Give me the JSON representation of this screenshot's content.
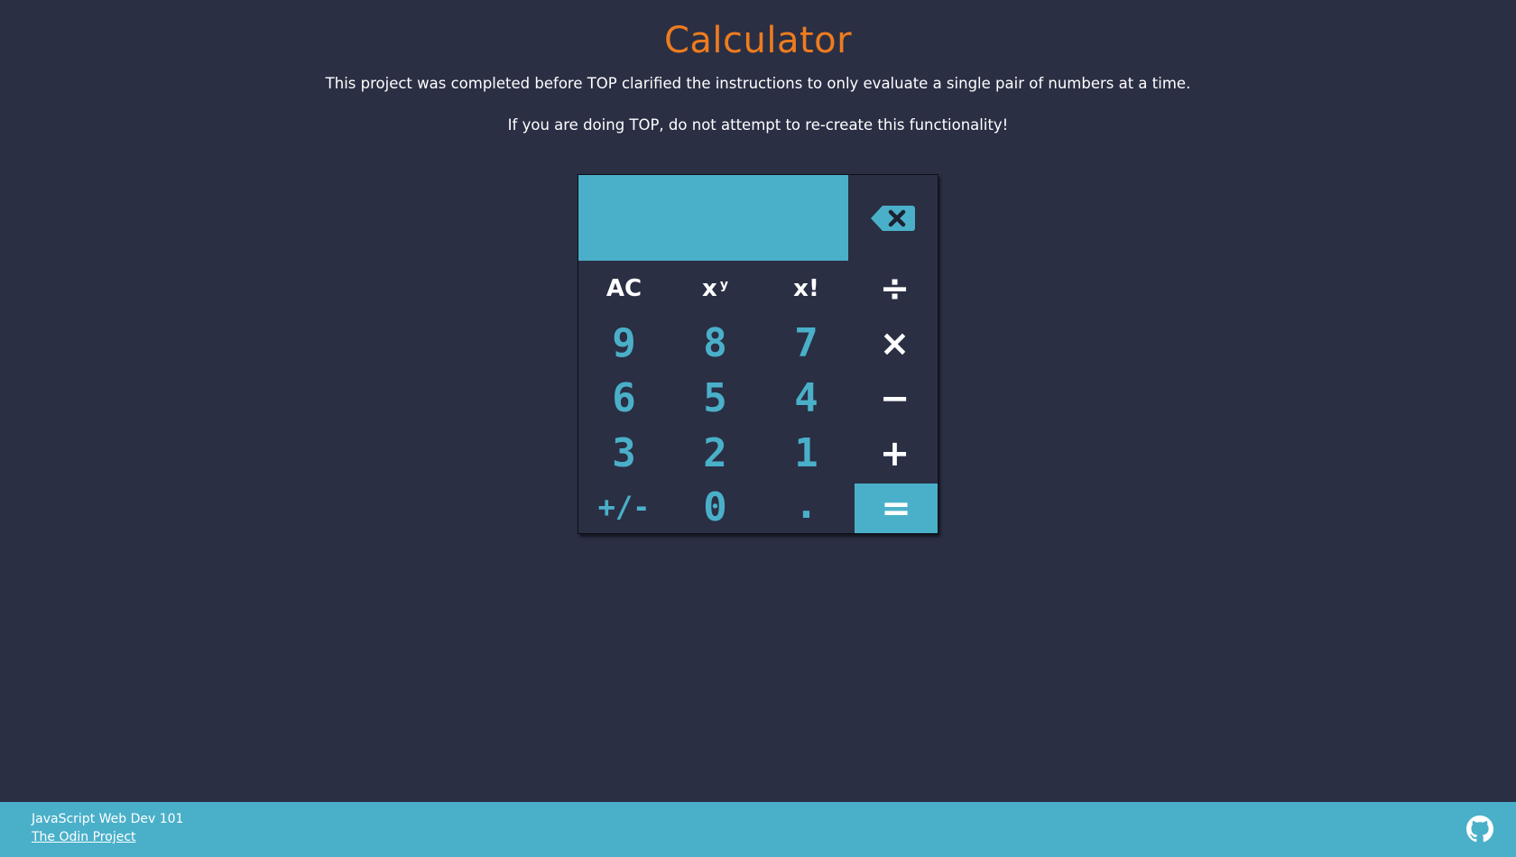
{
  "header": {
    "title": "Calculator",
    "note_1": "This project was completed before TOP clarified the instructions to only evaluate a single pair of numbers at a time.",
    "note_2": "If you are doing TOP, do not attempt to re-create this functionality!"
  },
  "calculator": {
    "display_value": "",
    "backspace_icon": "backspace-icon",
    "keys": {
      "clear": "AC",
      "power_base": "x",
      "power_exp": "y",
      "factorial": "x!",
      "divide": "÷",
      "nine": "9",
      "eight": "8",
      "seven": "7",
      "multiply": "×",
      "six": "6",
      "five": "5",
      "four": "4",
      "subtract": "−",
      "three": "3",
      "two": "2",
      "one": "1",
      "add": "+",
      "negate": "+/-",
      "zero": "0",
      "decimal": ".",
      "equals": "="
    }
  },
  "footer": {
    "course": "JavaScript Web Dev 101",
    "link_text": "The Odin Project",
    "github_icon": "github-icon"
  },
  "colors": {
    "background": "#2a2f44",
    "accent": "#4ab0c9",
    "title": "#ee7c1e",
    "text": "#ffffff"
  }
}
